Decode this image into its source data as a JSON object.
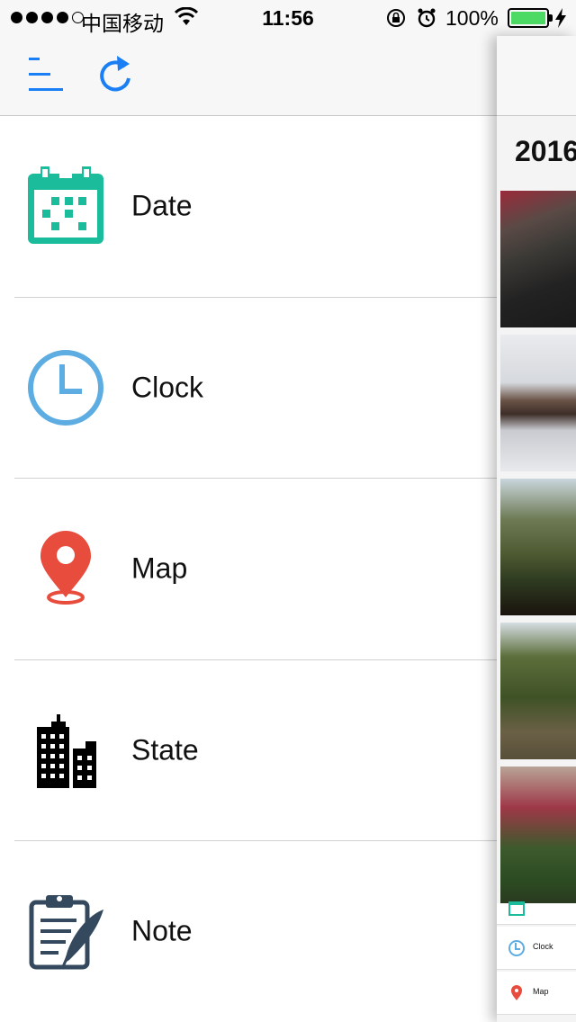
{
  "status_bar": {
    "carrier": "中国移动",
    "time": "11:56",
    "battery_percent": "100%",
    "battery_level": 1.0,
    "signal_bars": 4,
    "signal_total": 5
  },
  "toolbar": {
    "menu_icon": "menu-icon",
    "refresh_icon": "refresh-icon",
    "accent_color": "#1a7ef5"
  },
  "menu": {
    "items": [
      {
        "label": "Date",
        "icon": "calendar-icon",
        "color": "#1abc9c"
      },
      {
        "label": "Clock",
        "icon": "clock-icon",
        "color": "#5dade2"
      },
      {
        "label": "Map",
        "icon": "map-pin-icon",
        "color": "#e74c3c"
      },
      {
        "label": "State",
        "icon": "buildings-icon",
        "color": "#000000"
      },
      {
        "label": "Note",
        "icon": "clipboard-quill-icon",
        "color": "#34495e"
      }
    ]
  },
  "content_peek": {
    "year_heading": "2016",
    "photos": [
      "photo-1",
      "photo-2",
      "photo-3",
      "photo-4",
      "photo-5"
    ],
    "mini_items": [
      {
        "label": "Clock",
        "icon": "clock-icon"
      },
      {
        "label": "Map",
        "icon": "map-pin-icon"
      }
    ]
  }
}
